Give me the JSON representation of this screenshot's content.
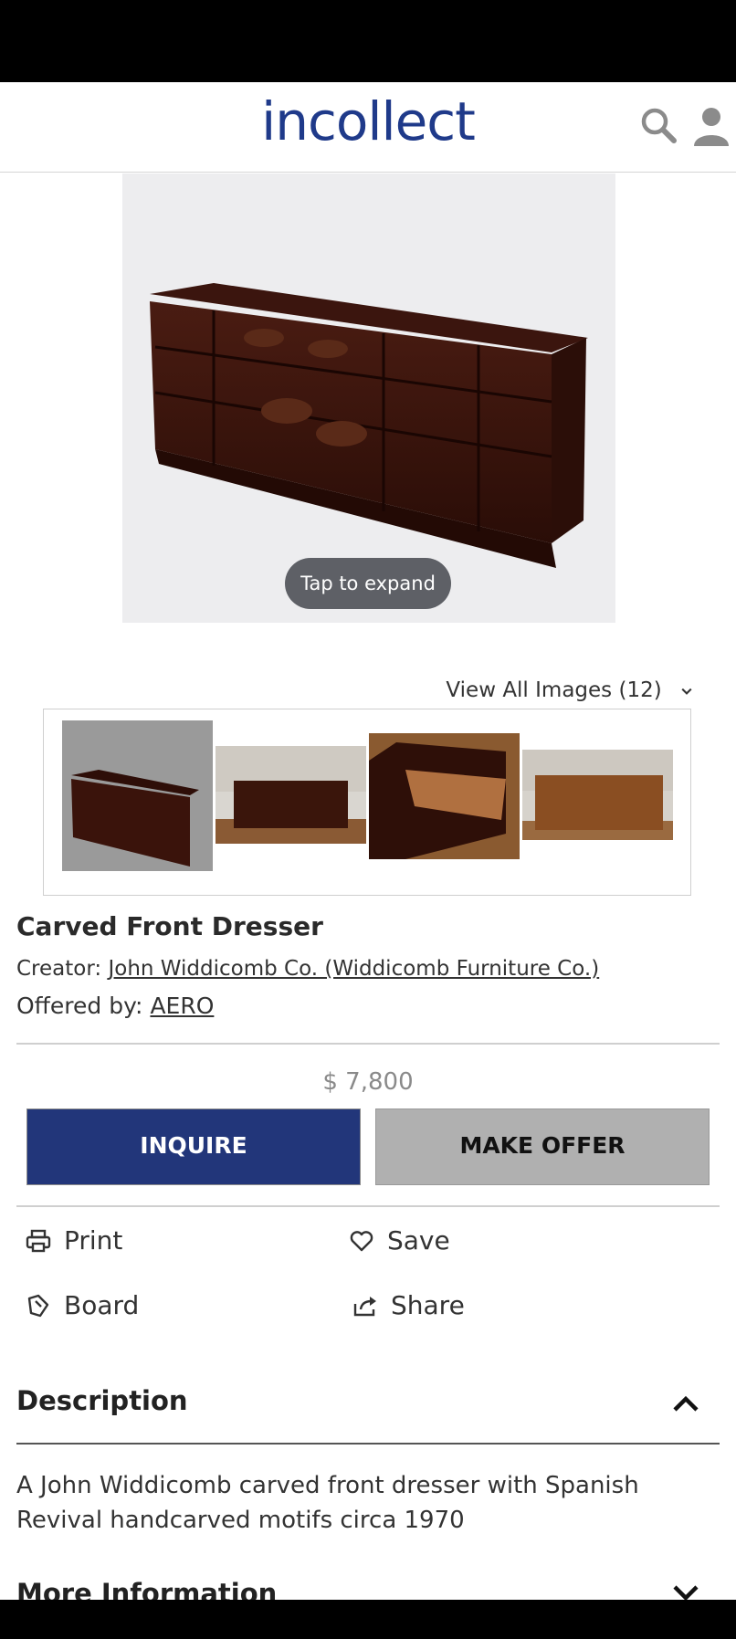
{
  "header": {
    "logo": "incollect"
  },
  "hero": {
    "tap_label": "Tap to expand"
  },
  "gallery": {
    "view_all_label": "View All Images (12)"
  },
  "product": {
    "title": "Carved Front Dresser",
    "creator_label": "Creator:",
    "creator_name": "John Widdicomb Co. (Widdicomb Furniture Co.)",
    "offered_label": "Offered by:",
    "offered_name": "AERO",
    "price": "$ 7,800"
  },
  "buttons": {
    "inquire": "INQUIRE",
    "make_offer": "MAKE OFFER"
  },
  "actions": {
    "print": "Print",
    "save": "Save",
    "board": "Board",
    "share": "Share"
  },
  "description": {
    "heading": "Description",
    "text": "A John Widdicomb carved front dresser with Spanish Revival handcarved motifs circa 1970"
  },
  "more_info": {
    "heading": "More Information"
  },
  "colors": {
    "brand": "#1f3a8a",
    "inquire_bg": "#22367a",
    "offer_bg": "#b0b0b0"
  },
  "icons": [
    "search-icon",
    "user-icon",
    "chevron-down-icon",
    "print-icon",
    "heart-icon",
    "board-icon",
    "share-icon",
    "chevron-up-icon"
  ]
}
